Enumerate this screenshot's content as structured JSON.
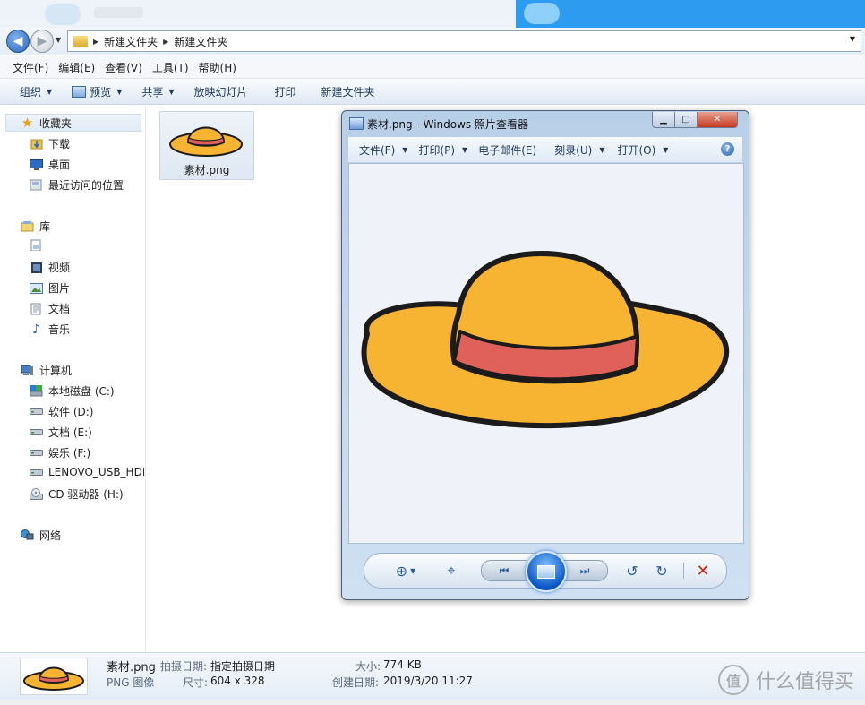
{
  "address": {
    "crumbs": [
      "新建文件夹",
      "新建文件夹"
    ]
  },
  "menubar": [
    "文件(F)",
    "编辑(E)",
    "查看(V)",
    "工具(T)",
    "帮助(H)"
  ],
  "toolbar": {
    "organize": "组织",
    "preview": "预览",
    "share": "共享",
    "slideshow": "放映幻灯片",
    "print": "打印",
    "new_folder": "新建文件夹"
  },
  "nav": {
    "favorites": "收藏夹",
    "downloads": "下载",
    "desktop": "桌面",
    "recent": "最近访问的位置",
    "libraries": "库",
    "videos": "视频",
    "pictures": "图片",
    "documents": "文档",
    "music": "音乐",
    "computer": "计算机",
    "drive_c": "本地磁盘 (C:)",
    "drive_d": "软件 (D:)",
    "drive_e": "文档 (E:)",
    "drive_f": "娱乐 (F:)",
    "drive_usb": "LENOVO_USB_HDD",
    "drive_h": "CD 驱动器 (H:)",
    "network": "网络"
  },
  "file": {
    "name": "素材.png"
  },
  "viewer": {
    "title": "素材.png - Windows 照片查看器",
    "menu": {
      "file": "文件(F)",
      "print": "打印(P)",
      "email": "电子邮件(E)",
      "burn": "刻录(U)",
      "open": "打开(O)"
    },
    "help": "?"
  },
  "details": {
    "filename": "素材.png",
    "type": "PNG 图像",
    "date_taken_label": "拍摄日期:",
    "date_taken_value": "指定拍摄日期",
    "dimensions_label": "尺寸:",
    "dimensions_value": "604 x 328",
    "size_label": "大小:",
    "size_value": "774 KB",
    "created_label": "创建日期:",
    "created_value": "2019/3/20 11:27"
  },
  "watermark": {
    "logo": "值",
    "text": "什么值得买"
  },
  "colors": {
    "hat_fill": "#f7b332",
    "hat_band": "#e0605a",
    "hat_outline": "#1b1b1b",
    "close_red": "#c63a21"
  }
}
